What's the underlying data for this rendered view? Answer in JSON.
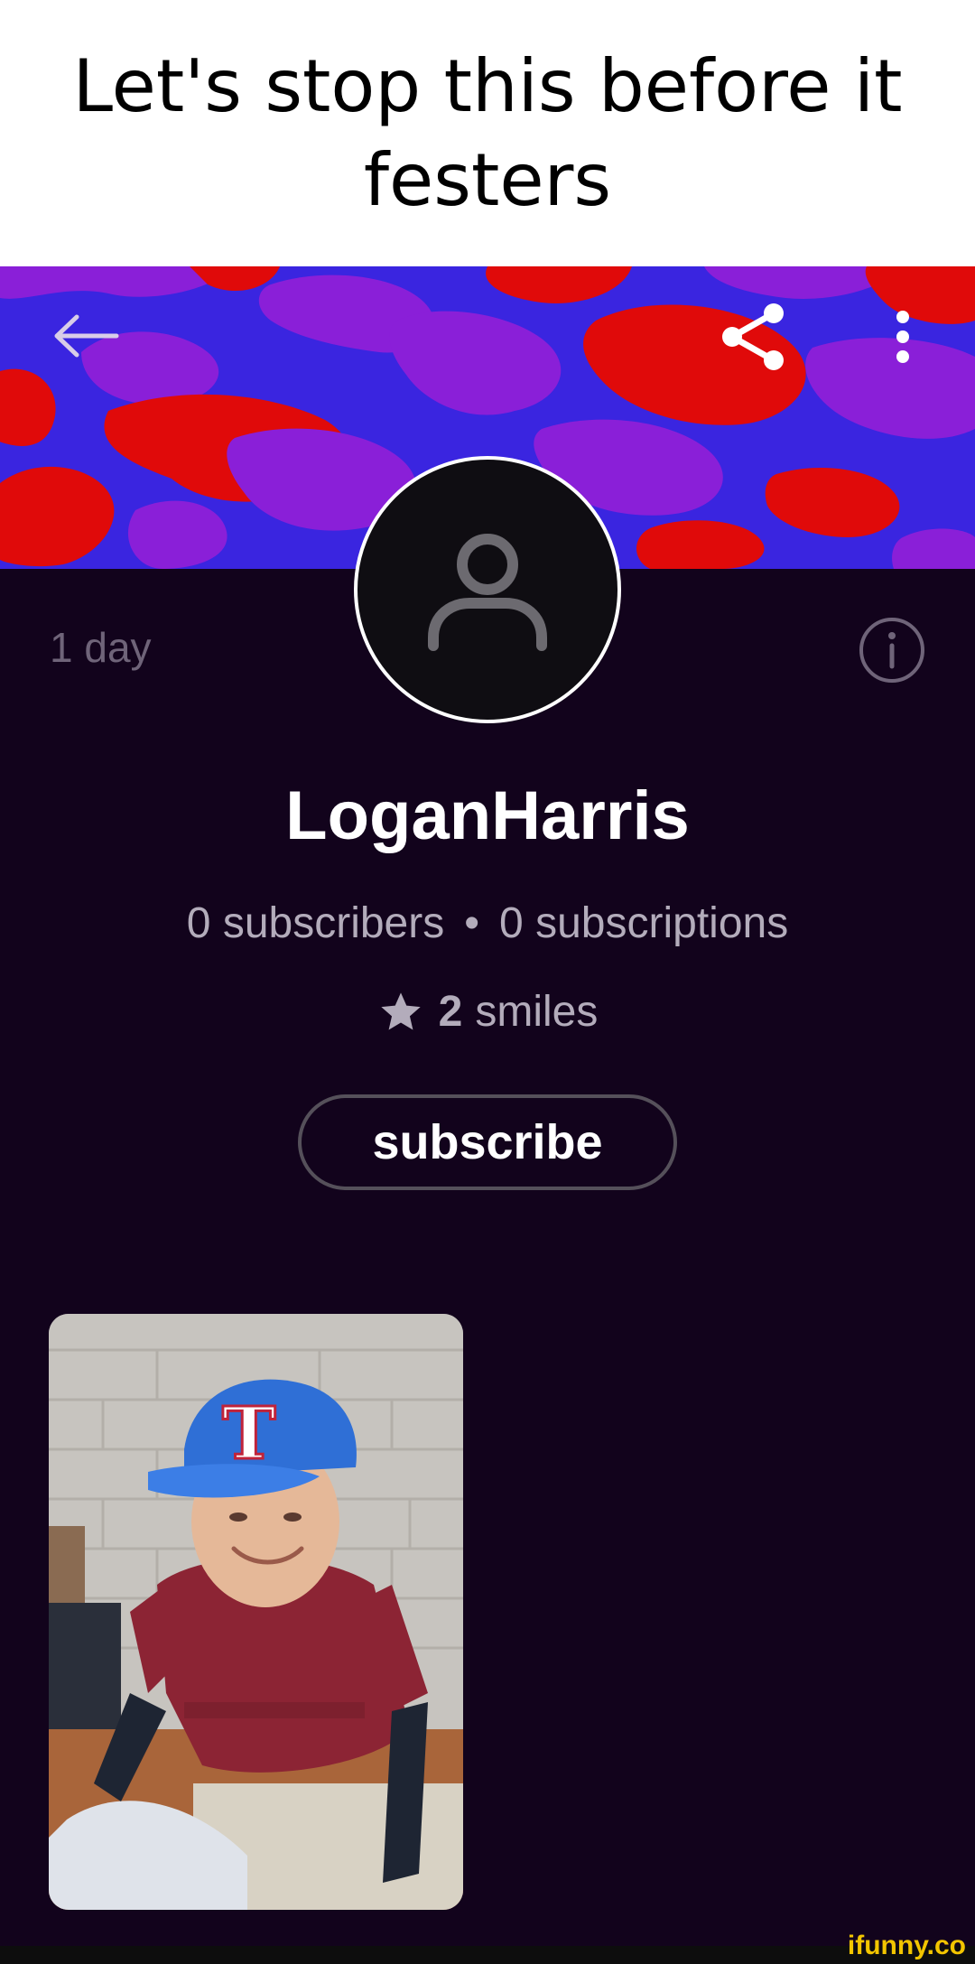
{
  "caption": "Let's stop this before it festers",
  "profile": {
    "username": "LoganHarris",
    "age": "1 day",
    "subscribers": "0 subscribers",
    "separator": "•",
    "subscriptions": "0 subscriptions",
    "smiles_count": "2",
    "smiles_label": "smiles",
    "subscribe_label": "subscribe"
  },
  "icons": {
    "back": "arrow-left-icon",
    "share": "share-icon",
    "more": "more-vertical-icon",
    "info": "info-icon",
    "avatar": "user-silhouette-icon",
    "star": "star-icon"
  },
  "colors": {
    "background": "#12031c",
    "banner_blue": "#3a25e0",
    "banner_red": "#e00a0a",
    "banner_purple": "#8a1fd8",
    "muted_text": "#b3acbb",
    "watermark": "#f2c500"
  },
  "watermark": "ifunny.co"
}
